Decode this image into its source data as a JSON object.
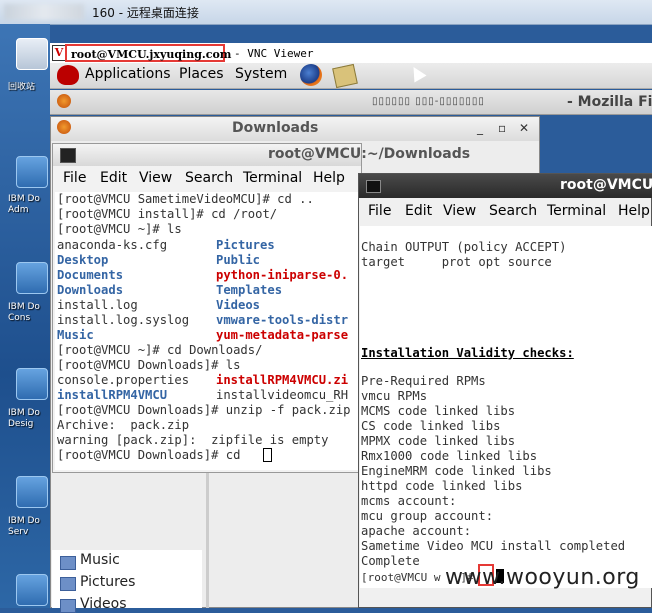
{
  "rdp": {
    "title": "160 - 远程桌面连接"
  },
  "desktop": {
    "icons": [
      {
        "label": "回收站"
      },
      {
        "label": "IBM Do"
      },
      {
        "label": "Adm"
      },
      {
        "label": "IBM Do"
      },
      {
        "label": "Cons"
      },
      {
        "label": "IBM Do"
      },
      {
        "label": "Desig"
      },
      {
        "label": "IBM Do"
      },
      {
        "label": "Serv"
      }
    ]
  },
  "vnc": {
    "host": "root@VMCU.jxyuqing.com",
    "app_title": "- VNC Viewer"
  },
  "panel": {
    "menus": [
      "Applications",
      "Places",
      "System"
    ]
  },
  "mozilla": {
    "title": "- Mozilla Fire",
    "garbled": "▯▯▯▯▯▯ ▯▯▯-▯▯▯▯▯▯▯"
  },
  "downloads": {
    "title": "Downloads",
    "controls": [
      "_",
      "▫",
      "✕"
    ],
    "sidebar": [
      "Music",
      "Pictures",
      "Videos"
    ]
  },
  "term1": {
    "title": "root@VMCU:~/Downloads",
    "menus": [
      "File",
      "Edit",
      "View",
      "Search",
      "Terminal",
      "Help"
    ],
    "lines": [
      "[root@VMCU SametimeVideoMCU]# cd ..",
      "[root@VMCU install]# cd /root/",
      "[root@VMCU ~]# ls",
      "anaconda-ks.cfg",
      "Desktop",
      "Documents",
      "Downloads",
      "install.log",
      "install.log.syslog",
      "Music",
      "[root@VMCU ~]# cd Downloads/",
      "[root@VMCU Downloads]# ls",
      "console.properties",
      "installRPM4VMCU",
      "[root@VMCU Downloads]# unzip -f pack.zip",
      "Archive:  pack.zip",
      "warning [pack.zip]:  zipfile is empty",
      "[root@VMCU Downloads]# cd "
    ],
    "col2": [
      "Pictures",
      "Public",
      "python-iniparse-0.",
      "Templates",
      "Videos",
      "vmware-tools-distr",
      "yum-metadata-parse",
      "installRPM4VMCU.zi",
      "installvideomcu_RH"
    ]
  },
  "term2": {
    "title": "root@VMCU:",
    "menus": [
      "File",
      "Edit",
      "View",
      "Search",
      "Terminal",
      "Help"
    ],
    "lines": [
      "Chain OUTPUT (policy ACCEPT)",
      "target     prot opt source",
      "Installation Validity checks:",
      "Pre-Required RPMs",
      "vmcu RPMs",
      "MCMS code linked libs",
      "CS code linked libs",
      "MPMX code linked libs",
      "Rmx1000 code linked libs",
      "EngineMRM code linked libs",
      "httpd code linked libs",
      "mcms account:",
      "mcu group account:",
      "apache account:",
      "Sametime Video MCU install completed",
      "Complete",
      "[root@VMCU w   ]# "
    ]
  },
  "watermark": "www.wooyun.org",
  "colors": {
    "dir_blue": "#3465a4",
    "archive_red": "#cc0000",
    "highlight": "#e53935"
  }
}
